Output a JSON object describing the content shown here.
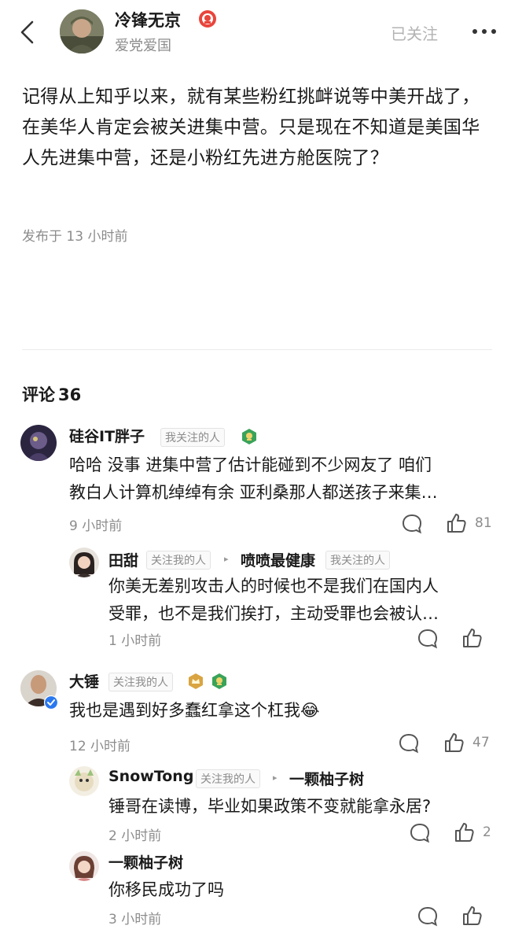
{
  "header": {
    "author_name": "冷锋无京",
    "author_subtitle": "爱党爱国",
    "follow_label": "已关注"
  },
  "post": {
    "body": "记得从上知乎以来，就有某些粉红挑衅说等中美开战了，在美华人肯定会被关进集中营。只是现在不知道是美国华人先进集中营，还是小粉红先进方舱医院了？",
    "time": "发布于 13 小时前"
  },
  "comments_header": {
    "label": "评论",
    "count": "36"
  },
  "comments": [
    {
      "name": "硅谷IT胖子",
      "tag": "我关注的人",
      "text_line1": "哈哈 没事 进集中营了估计能碰到不少网友了 咱们",
      "text_line2": "教白人计算机绰绰有余 亚利桑那人都送孩子来集…",
      "time": "9 小时前",
      "likes": "81",
      "replies": [
        {
          "name": "田甜",
          "tag": "关注我的人",
          "reply_to": "喷喷最健康",
          "reply_to_tag": "我关注的人",
          "text_line1": "你美无差别攻击人的时候也不是我们在国内人",
          "text_line2": "受罪，也不是我们挨打，主动受罪也会被认…",
          "time": "1 小时前"
        }
      ]
    },
    {
      "name": "大锤",
      "tag": "关注我的人",
      "text_line1": "我也是遇到好多蠢红拿这个杠我",
      "emoji": "😂",
      "time": "12 小时前",
      "likes": "47",
      "replies": [
        {
          "name": "SnowTong",
          "tag": "关注我的人",
          "reply_to": "一颗柚子树",
          "text_line1": "锤哥在读博，毕业如果政策不变就能拿永居?",
          "time": "2 小时前",
          "likes": "2"
        },
        {
          "name": "一颗柚子树",
          "text_line1": "你移民成功了吗",
          "time": "3 小时前"
        }
      ]
    }
  ],
  "colors": {
    "text_primary": "#1a1a1a",
    "text_secondary": "#8c8c8c",
    "follow_gray": "#b3b3b3",
    "badge_red": "#e8453c",
    "badge_green": "#3aa35a",
    "badge_gold": "#d9a441",
    "verified_blue": "#2a78f0"
  },
  "icons": [
    "back-arrow-icon",
    "more-dots-icon",
    "comment-bubble-icon",
    "thumbs-up-icon",
    "verified-badge-icon",
    "achievement-badge-icon"
  ]
}
